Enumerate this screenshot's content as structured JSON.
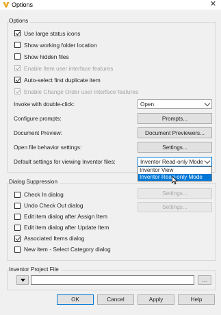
{
  "window": {
    "title": "Options",
    "close_glyph": "✕"
  },
  "options_group": {
    "label": "Options",
    "checkboxes": [
      {
        "label": "Use large status icons",
        "checked": true,
        "disabled": false
      },
      {
        "label": "Show working folder location",
        "checked": false,
        "disabled": false
      },
      {
        "label": "Show hidden files",
        "checked": false,
        "disabled": false
      },
      {
        "label": "Enable Item user interface features",
        "checked": true,
        "disabled": true
      },
      {
        "label": "Auto-select first duplicate item",
        "checked": true,
        "disabled": false
      },
      {
        "label": "Enable Change Order user interface features",
        "checked": true,
        "disabled": true
      }
    ],
    "invoke_label": "Invoke with double-click:",
    "invoke_value": "Open",
    "configure_label": "Configure prompts:",
    "configure_button": "Prompts...",
    "preview_label": "Document Preview:",
    "preview_button": "Document Previewers...",
    "open_file_label": "Open file behavior settings:",
    "open_file_button": "Settings...",
    "default_view_label": "Default settings for viewing Inventor files:",
    "default_view_value": "Inventor Read-only Mode",
    "default_view_options": [
      "Inventor View",
      "Inventor Read-only Mode"
    ]
  },
  "suppression_group": {
    "label": "Dialog Suppression",
    "checkboxes": [
      {
        "label": "Check In dialog",
        "checked": false
      },
      {
        "label": "Undo Check Out dialog",
        "checked": false
      },
      {
        "label": "Edit item dialog after Assign Item",
        "checked": false
      },
      {
        "label": "Edit item dialog after Update Item",
        "checked": false
      },
      {
        "label": "Associated Items dialog",
        "checked": true
      },
      {
        "label": "New item - Select Category dialog",
        "checked": false
      }
    ],
    "settings_button_1": "Settings...",
    "settings_button_2": "Settings..."
  },
  "project_group": {
    "label": "Inventor Project File",
    "path_value": "",
    "browse_button": "..."
  },
  "footer": {
    "ok": "OK",
    "cancel": "Cancel",
    "apply": "Apply",
    "help": "Help"
  },
  "colors": {
    "accent": "#0078d7",
    "app_icon": "#e8a317"
  }
}
